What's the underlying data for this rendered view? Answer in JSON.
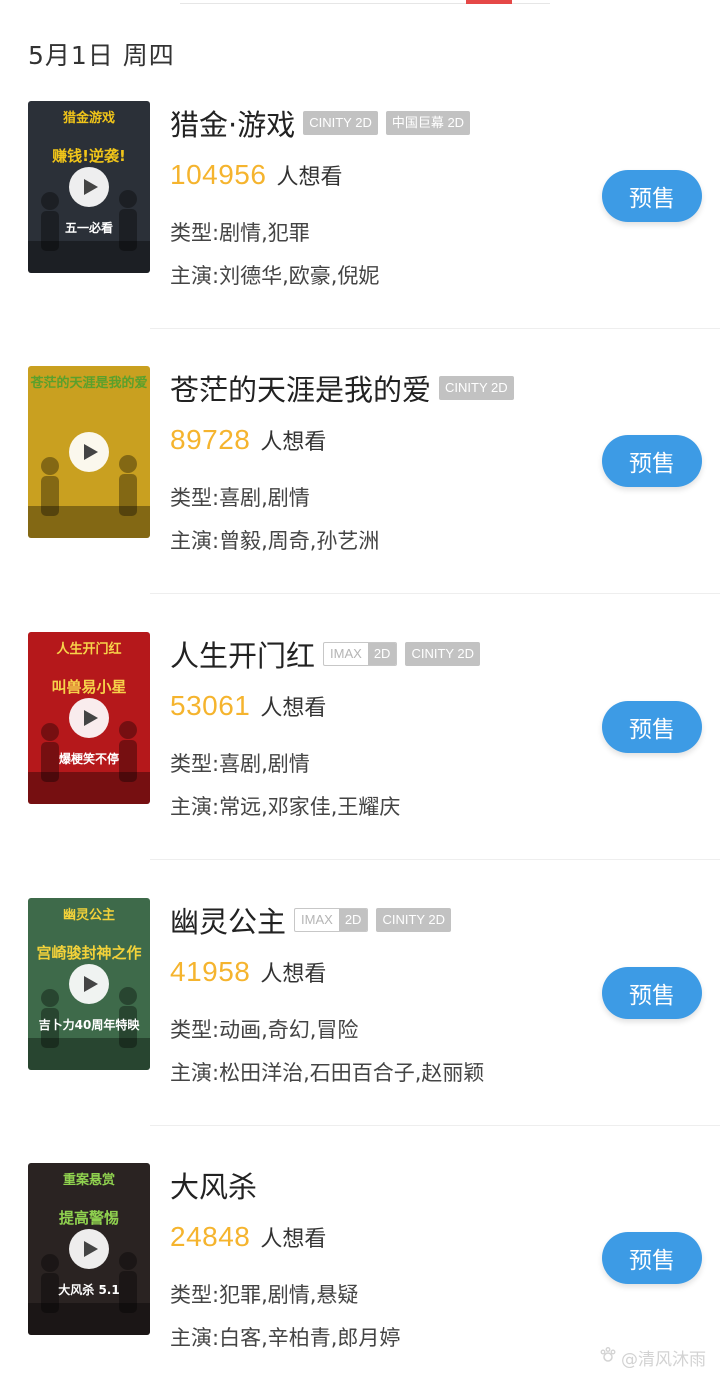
{
  "date_heading": "5月1日 周四",
  "presale_label": "预售",
  "want_suffix": "人想看",
  "watermark": "@清风沐雨",
  "movies": [
    {
      "title": "猎金·游戏",
      "tags": [
        {
          "type": "gray",
          "text": "CINITY 2D"
        },
        {
          "type": "gray",
          "text": "中国巨幕 2D"
        }
      ],
      "want_count": "104956",
      "genre": "类型:剧情,犯罪",
      "cast": "主演:刘德华,欧豪,倪妮",
      "poster": {
        "bg": "#2b3038",
        "top_text": "猎金游戏",
        "mid_text": "赚钱!逆袭!",
        "low_text": "五一必看",
        "accent": "#f0c419"
      }
    },
    {
      "title": "苍茫的天涯是我的爱",
      "tags": [
        {
          "type": "gray",
          "text": "CINITY 2D"
        }
      ],
      "want_count": "89728",
      "genre": "类型:喜剧,剧情",
      "cast": "主演:曾毅,周奇,孙艺洲",
      "poster": {
        "bg": "#c9a020",
        "top_text": "苍茫的天涯是我的爱",
        "mid_text": "",
        "low_text": "",
        "accent": "#5aa02c"
      }
    },
    {
      "title": "人生开门红",
      "tags": [
        {
          "type": "outline",
          "text": "IMAX",
          "sub": "2D"
        },
        {
          "type": "gray",
          "text": "CINITY 2D"
        }
      ],
      "want_count": "53061",
      "genre": "类型:喜剧,剧情",
      "cast": "主演:常远,邓家佳,王耀庆",
      "poster": {
        "bg": "#b5181b",
        "top_text": "人生开门红",
        "mid_text": "叫兽易小星",
        "low_text": "爆梗笑不停",
        "accent": "#f7d34a"
      }
    },
    {
      "title": "幽灵公主",
      "tags": [
        {
          "type": "outline",
          "text": "IMAX",
          "sub": "2D"
        },
        {
          "type": "gray",
          "text": "CINITY 2D"
        }
      ],
      "want_count": "41958",
      "genre": "类型:动画,奇幻,冒险",
      "cast": "主演:松田洋治,石田百合子,赵丽颖",
      "poster": {
        "bg": "#3e6a4a",
        "top_text": "幽灵公主",
        "mid_text": "宫崎骏封神之作",
        "low_text": "吉卜力40周年特映",
        "accent": "#f3d23a"
      }
    },
    {
      "title": "大风杀",
      "tags": [],
      "want_count": "24848",
      "genre": "类型:犯罪,剧情,悬疑",
      "cast": "主演:白客,辛柏青,郎月婷",
      "poster": {
        "bg": "#2a2322",
        "top_text": "重案悬赏",
        "mid_text": "提高警惕",
        "low_text": "大风杀 5.1",
        "accent": "#8fd14f"
      }
    }
  ]
}
